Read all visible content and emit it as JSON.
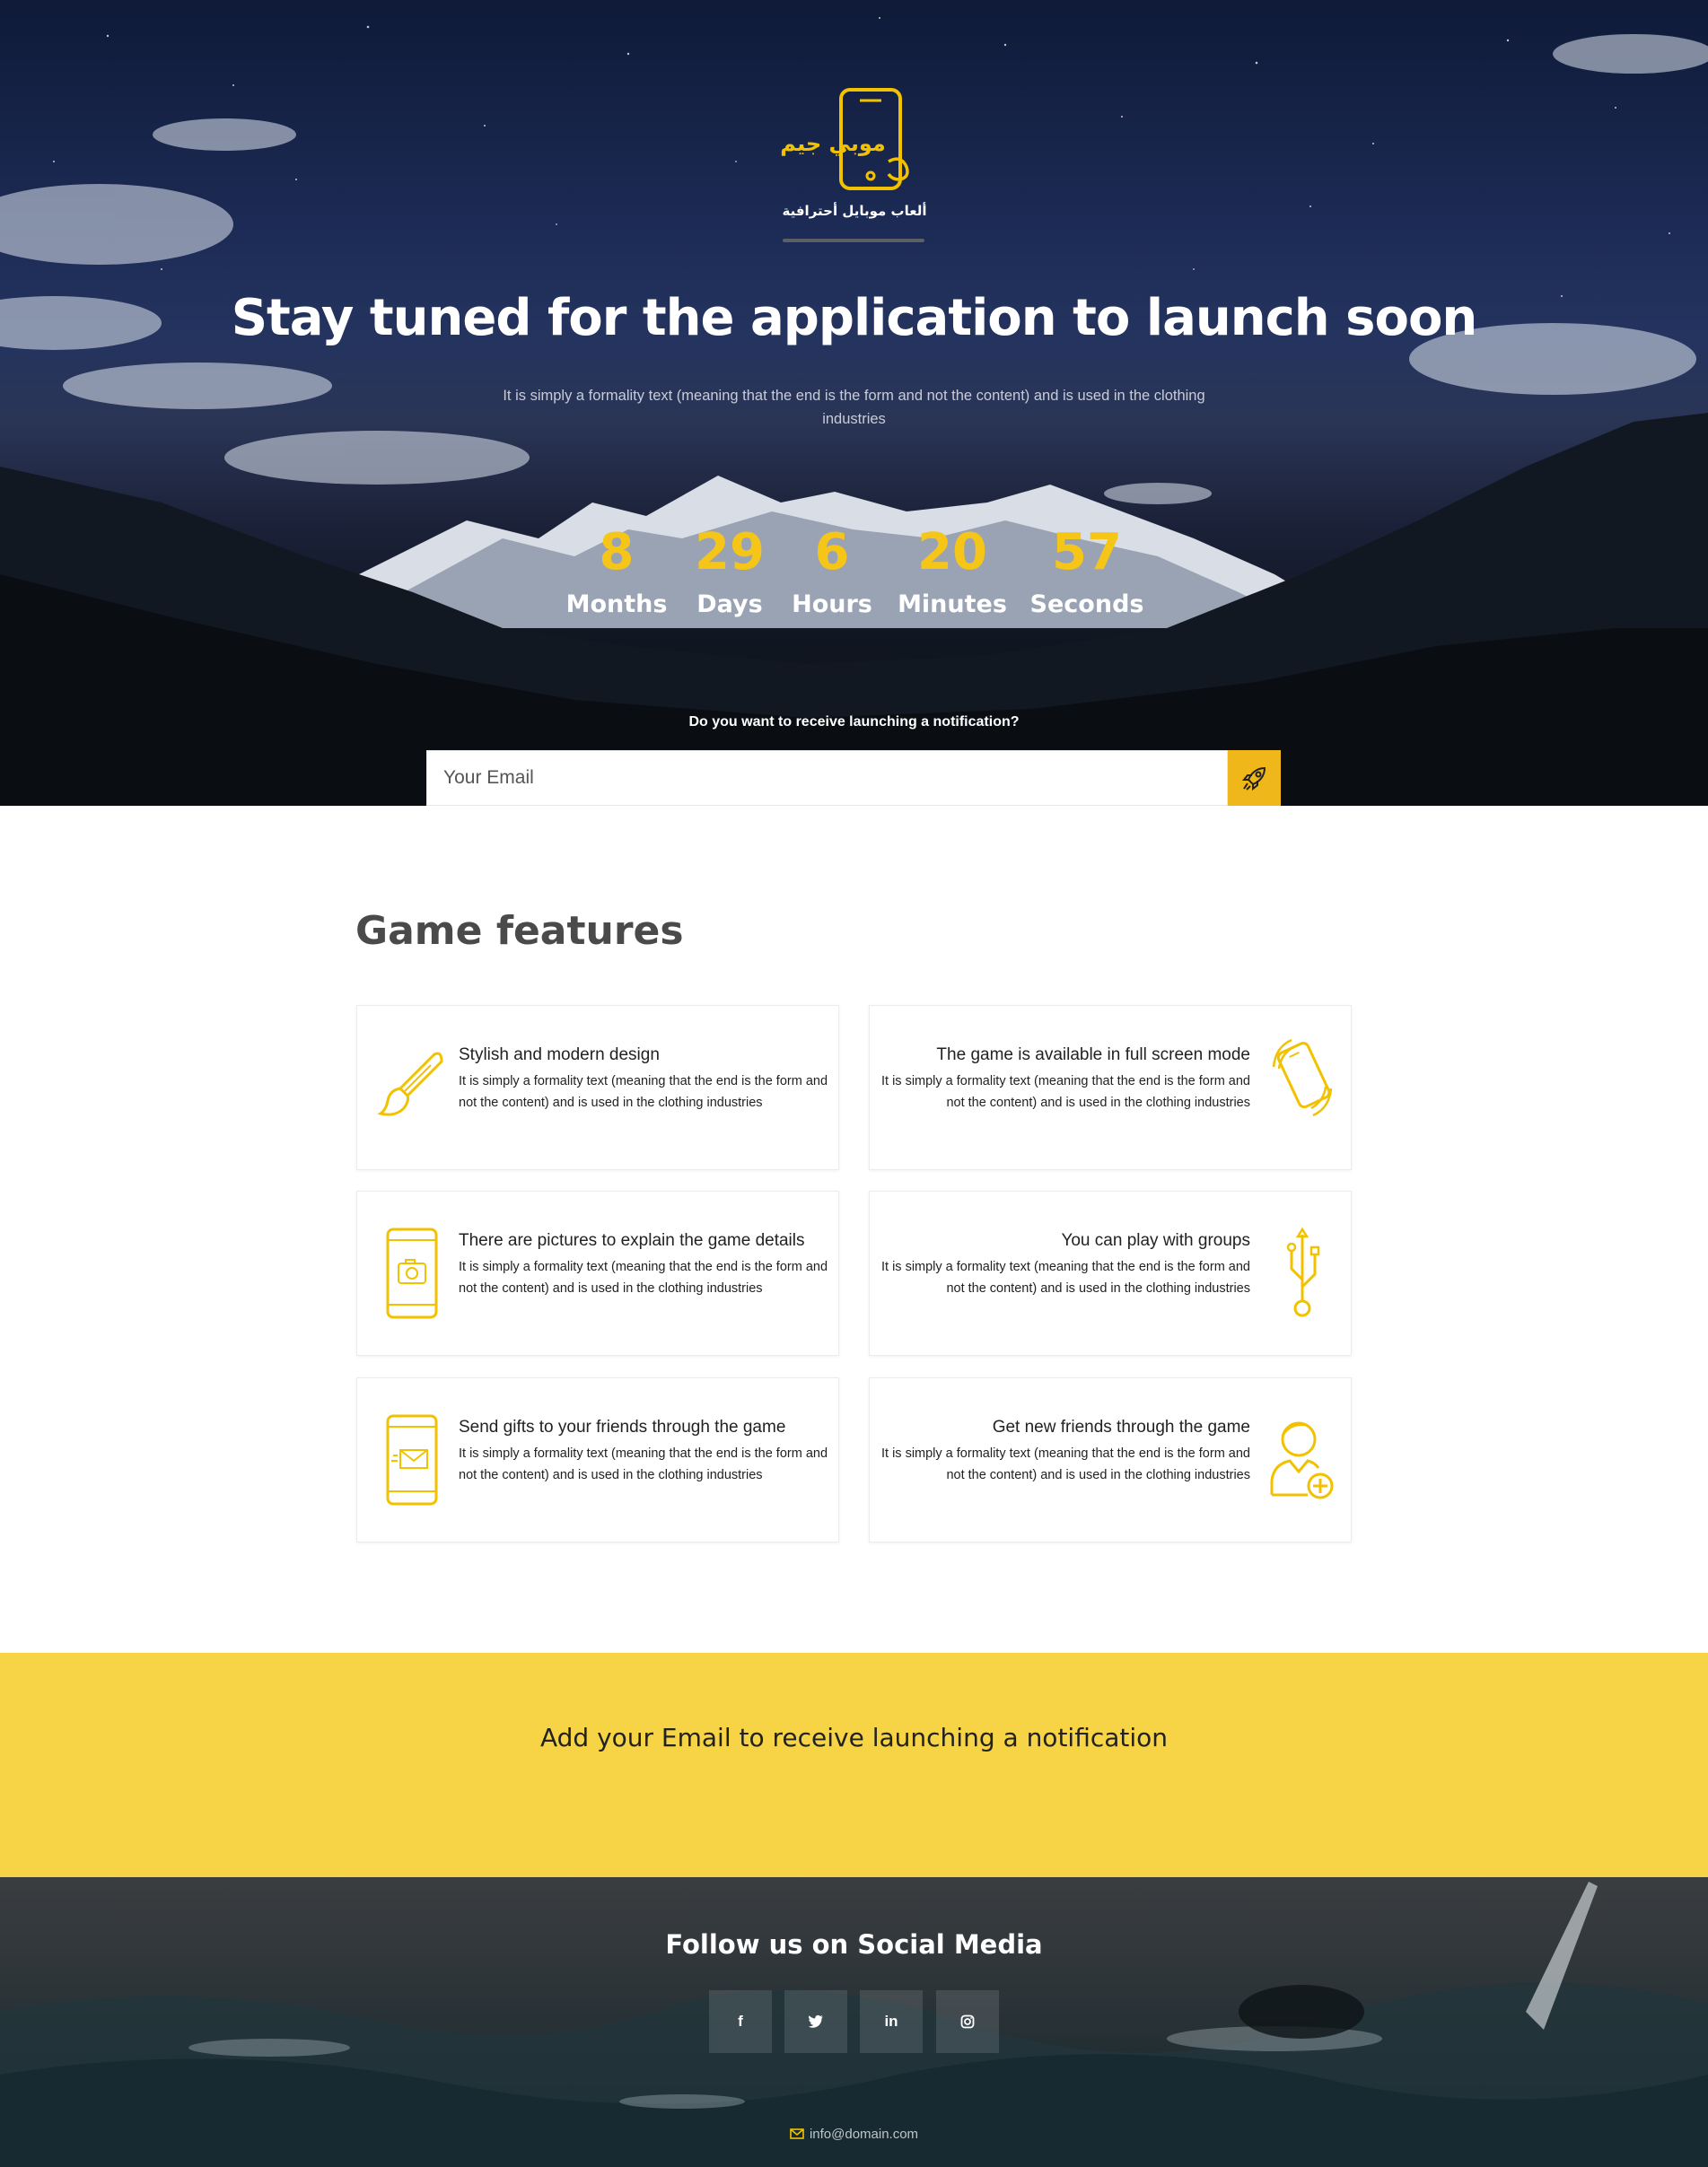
{
  "hero": {
    "logo_text_ar": "موبي جيم",
    "logo_sub_ar": "ألعاب موبايل أحترافية",
    "title": "Stay tuned for the application to launch soon",
    "subtitle": "It is simply a formality text (meaning that the end is the form and not the content) and is used in the clothing industries",
    "countdown": [
      {
        "value": "8",
        "label": "Months"
      },
      {
        "value": "29",
        "label": "Days"
      },
      {
        "value": "6",
        "label": "Hours"
      },
      {
        "value": "20",
        "label": "Minutes"
      },
      {
        "value": "57",
        "label": "Seconds"
      }
    ],
    "notify_question": "Do you want to receive launching a notification?",
    "email_placeholder": "Your Email",
    "submit_icon": "rocket-icon"
  },
  "features": {
    "title": "Game features",
    "cards": [
      {
        "title": "Stylish and modern design",
        "text": "It is simply a formality text (meaning that the end is the form and not the content) and is used in the clothing industries",
        "icon": "paintbrush-icon"
      },
      {
        "title": "The game is available in full screen mode",
        "text": "It is simply a formality text (meaning that the end is the form and not the content) and is used in the clothing industries",
        "icon": "phone-rotate-icon"
      },
      {
        "title": "There are pictures to explain the game details",
        "text": "It is simply a formality text (meaning that the end is the form and not the content) and is used in the clothing industries",
        "icon": "phone-camera-icon"
      },
      {
        "title": "You can play with groups",
        "text": "It is simply a formality text (meaning that the end is the form and not the content) and is used in the clothing industries",
        "icon": "usb-icon"
      },
      {
        "title": "Send gifts to your friends through the game",
        "text": "It is simply a formality text (meaning that the end is the form and not the content) and is used in the clothing industries",
        "icon": "phone-mail-icon"
      },
      {
        "title": "Get new friends through the game",
        "text": "It is simply a formality text (meaning that the end is the form and not the content) and is used in the clothing industries",
        "icon": "add-user-icon"
      }
    ]
  },
  "cta": {
    "text": "Add your Email to receive launching a notification"
  },
  "footer": {
    "follow": "Follow us on Social Media",
    "socials": [
      {
        "label": "f",
        "icon": "facebook-icon"
      },
      {
        "label": "🐦",
        "icon": "twitter-icon"
      },
      {
        "label": "in",
        "icon": "linkedin-icon"
      },
      {
        "label": "◎",
        "icon": "instagram-icon"
      }
    ],
    "email": "info@domain.com"
  },
  "colors": {
    "accent": "#f5c518",
    "button": "#f0b71a",
    "band": "#f7d445",
    "icon_stroke": "#f2c200"
  }
}
